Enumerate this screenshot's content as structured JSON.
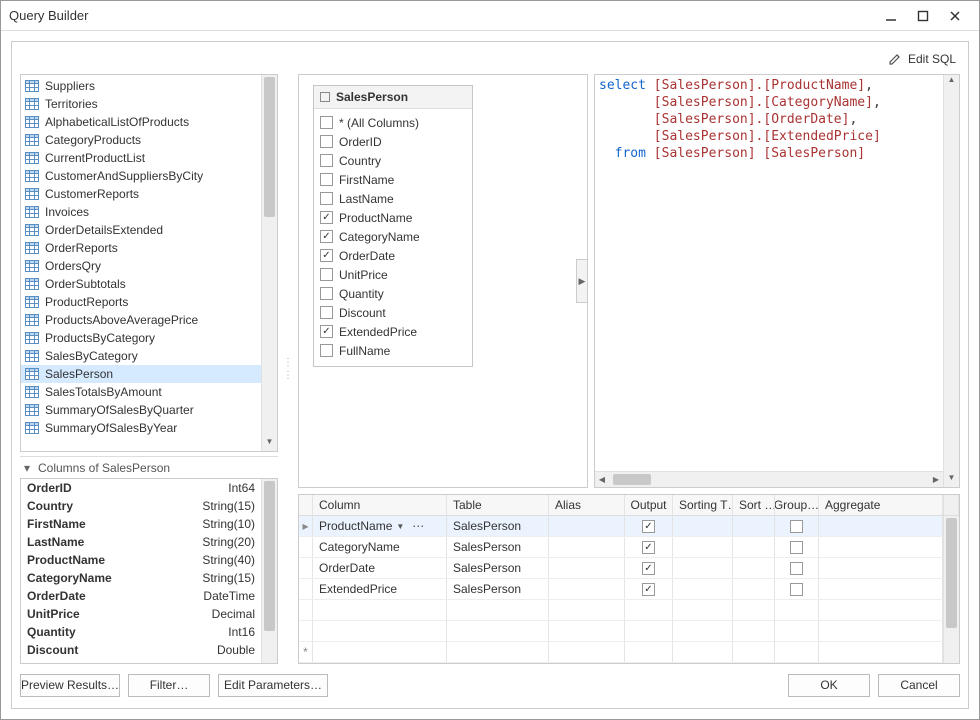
{
  "window": {
    "title": "Query Builder",
    "edit_sql": "Edit SQL"
  },
  "tables": [
    "Suppliers",
    "Territories",
    "AlphabeticalListOfProducts",
    "CategoryProducts",
    "CurrentProductList",
    "CustomerAndSuppliersByCity",
    "CustomerReports",
    "Invoices",
    "OrderDetailsExtended",
    "OrderReports",
    "OrdersQry",
    "OrderSubtotals",
    "ProductReports",
    "ProductsAboveAveragePrice",
    "ProductsByCategory",
    "SalesByCategory",
    "SalesPerson",
    "SalesTotalsByAmount",
    "SummaryOfSalesByQuarter",
    "SummaryOfSalesByYear"
  ],
  "tables_selected_index": 16,
  "columns_of": {
    "header": "Columns of SalesPerson",
    "items": [
      {
        "name": "OrderID",
        "type": "Int64"
      },
      {
        "name": "Country",
        "type": "String(15)"
      },
      {
        "name": "FirstName",
        "type": "String(10)"
      },
      {
        "name": "LastName",
        "type": "String(20)"
      },
      {
        "name": "ProductName",
        "type": "String(40)"
      },
      {
        "name": "CategoryName",
        "type": "String(15)"
      },
      {
        "name": "OrderDate",
        "type": "DateTime"
      },
      {
        "name": "UnitPrice",
        "type": "Decimal"
      },
      {
        "name": "Quantity",
        "type": "Int16"
      },
      {
        "name": "Discount",
        "type": "Double"
      }
    ]
  },
  "entity": {
    "title": "SalesPerson",
    "fields": [
      {
        "label": "* (All Columns)",
        "checked": false
      },
      {
        "label": "OrderID",
        "checked": false
      },
      {
        "label": "Country",
        "checked": false
      },
      {
        "label": "FirstName",
        "checked": false
      },
      {
        "label": "LastName",
        "checked": false
      },
      {
        "label": "ProductName",
        "checked": true
      },
      {
        "label": "CategoryName",
        "checked": true
      },
      {
        "label": "OrderDate",
        "checked": true
      },
      {
        "label": "UnitPrice",
        "checked": false
      },
      {
        "label": "Quantity",
        "checked": false
      },
      {
        "label": "Discount",
        "checked": false
      },
      {
        "label": "ExtendedPrice",
        "checked": true
      },
      {
        "label": "FullName",
        "checked": false
      }
    ]
  },
  "grid": {
    "headers": {
      "column": "Column",
      "table": "Table",
      "alias": "Alias",
      "output": "Output",
      "sort_type": "Sorting T…",
      "sort_order": "Sort …",
      "group_by": "Group…",
      "aggregate": "Aggregate"
    },
    "rows": [
      {
        "column": "ProductName",
        "table": "SalesPerson",
        "alias": "",
        "output": true,
        "group_by": false,
        "selected": true,
        "editing": true
      },
      {
        "column": "CategoryName",
        "table": "SalesPerson",
        "alias": "",
        "output": true,
        "group_by": false
      },
      {
        "column": "OrderDate",
        "table": "SalesPerson",
        "alias": "",
        "output": true,
        "group_by": false
      },
      {
        "column": "ExtendedPrice",
        "table": "SalesPerson",
        "alias": "",
        "output": true,
        "group_by": false
      }
    ],
    "empty_rows": 2,
    "new_row_marker": "*"
  },
  "sql": {
    "kw_select": "select",
    "kw_from": "from",
    "lines": [
      {
        "pre": "",
        "col": "[SalesPerson].[ProductName]",
        "comma": ","
      },
      {
        "pre": "       ",
        "col": "[SalesPerson].[CategoryName]",
        "comma": ","
      },
      {
        "pre": "       ",
        "col": "[SalesPerson].[OrderDate]",
        "comma": ","
      },
      {
        "pre": "       ",
        "col": "[SalesPerson].[ExtendedPrice]",
        "comma": ""
      }
    ],
    "from_tbl": "[SalesPerson]",
    "from_alias": "[SalesPerson]"
  },
  "buttons": {
    "preview": "Preview Results…",
    "filter": "Filter…",
    "params": "Edit Parameters…",
    "ok": "OK",
    "cancel": "Cancel"
  }
}
